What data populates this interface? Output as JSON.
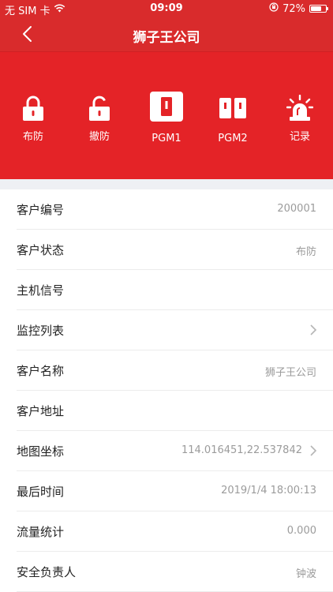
{
  "status_bar": {
    "carrier": "无 SIM 卡",
    "time": "09:09",
    "battery": "72%",
    "battery_level": 0.72,
    "icons": [
      "wifi-icon",
      "orientation-lock-icon",
      "battery-icon"
    ]
  },
  "nav": {
    "title": "狮子王公司",
    "back_icon": "chevron-left-icon"
  },
  "actions": [
    {
      "label": "布防",
      "icon": "lock-closed-icon"
    },
    {
      "label": "撤防",
      "icon": "lock-open-icon"
    },
    {
      "label": "PGM1",
      "icon": "pgm1-switch-icon"
    },
    {
      "label": "PGM2",
      "icon": "pgm2-switch-icon"
    },
    {
      "label": "记录",
      "icon": "alarm-light-icon"
    }
  ],
  "details": [
    {
      "key": "客户编号",
      "value": "200001",
      "chevron": false
    },
    {
      "key": "客户状态",
      "value": "布防",
      "chevron": false
    },
    {
      "key": "主机信号",
      "value": "",
      "chevron": false
    },
    {
      "key": "监控列表",
      "value": "",
      "chevron": true
    },
    {
      "key": "客户名称",
      "value": "狮子王公司",
      "chevron": false
    },
    {
      "key": "客户地址",
      "value": "",
      "chevron": false
    },
    {
      "key": "地图坐标",
      "value": "114.016451,22.537842",
      "chevron": true
    },
    {
      "key": "最后时间",
      "value": "2019/1/4 18:00:13",
      "chevron": false
    },
    {
      "key": "流量统计",
      "value": "0.000",
      "chevron": false
    },
    {
      "key": "安全负责人",
      "value": "钟波",
      "chevron": false
    }
  ],
  "colors": {
    "header_red": "#d92b2c",
    "panel_red": "#e42327",
    "value_gray": "#9b9b9b",
    "divider": "#ececec"
  }
}
